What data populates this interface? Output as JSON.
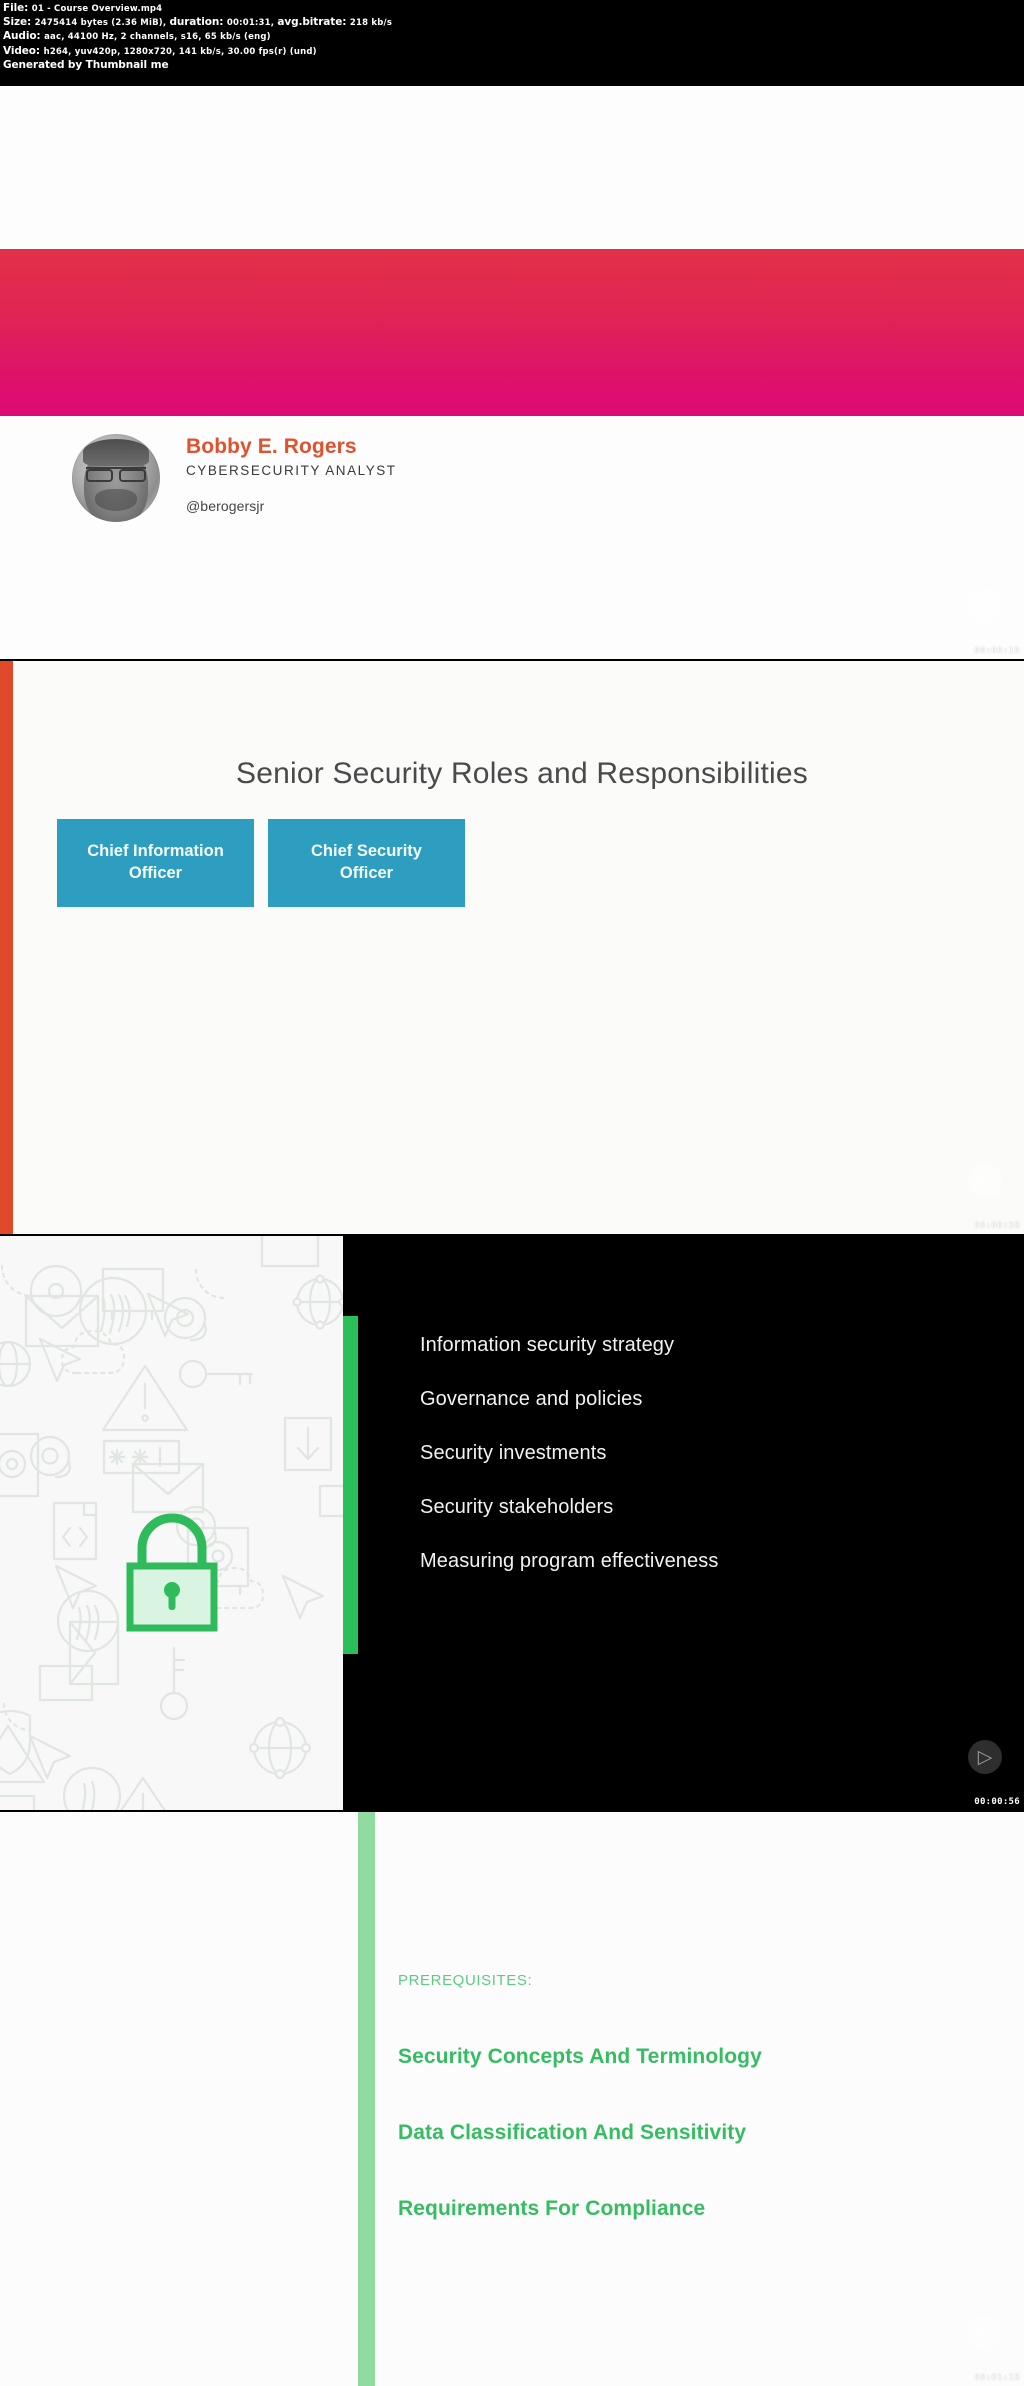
{
  "meta": {
    "file_label": "File:",
    "file_name": "01 - Course Overview.mp4",
    "size_label": "Size:",
    "size_value": "2475414 bytes (2.36 MiB), ",
    "duration_label": "duration:",
    "duration_value": " 00:01:31, ",
    "bitrate_label": "avg.bitrate:",
    "bitrate_value": " 218 kb/s",
    "audio_label": "Audio:",
    "audio_value": " aac, 44100 Hz, 2 channels, s16, 65 kb/s (eng)",
    "video_label": "Video:",
    "video_value": " h264, yuv420p, 1280x720, 141 kb/s, 30.00 fps(r) (und)",
    "generator": "Generated by Thumbnail me"
  },
  "thumbnails": [
    {
      "timestamp": "00:00:19",
      "author": {
        "name": "Bobby E. Rogers",
        "role": "CYBERSECURITY ANALYST",
        "handle": "@berogersjr"
      }
    },
    {
      "timestamp": "00:00:38",
      "title": "Senior Security Roles and Responsibilities",
      "cards": [
        "Chief Information Officer",
        "Chief Security Officer"
      ]
    },
    {
      "timestamp": "00:00:56",
      "bullets": [
        "Information security strategy",
        "Governance and policies",
        "Security investments",
        "Security stakeholders",
        "Measuring program effectiveness"
      ]
    },
    {
      "timestamp": "00:01:15",
      "prereq_label": "PREREQUISITES:",
      "prereqs": [
        "Security Concepts And Terminology",
        "Data Classification And Sensitivity",
        "Requirements For Compliance"
      ]
    }
  ],
  "icons": {
    "play": "▷"
  },
  "colors": {
    "accent_orange": "#e0492a",
    "accent_teal": "#2e9ec0",
    "accent_green": "#2bbf5a",
    "accent_green_light": "#8fdba0",
    "author_name": "#e0522e",
    "gradient_top": "#e23049",
    "gradient_bottom": "#dd0a76"
  }
}
